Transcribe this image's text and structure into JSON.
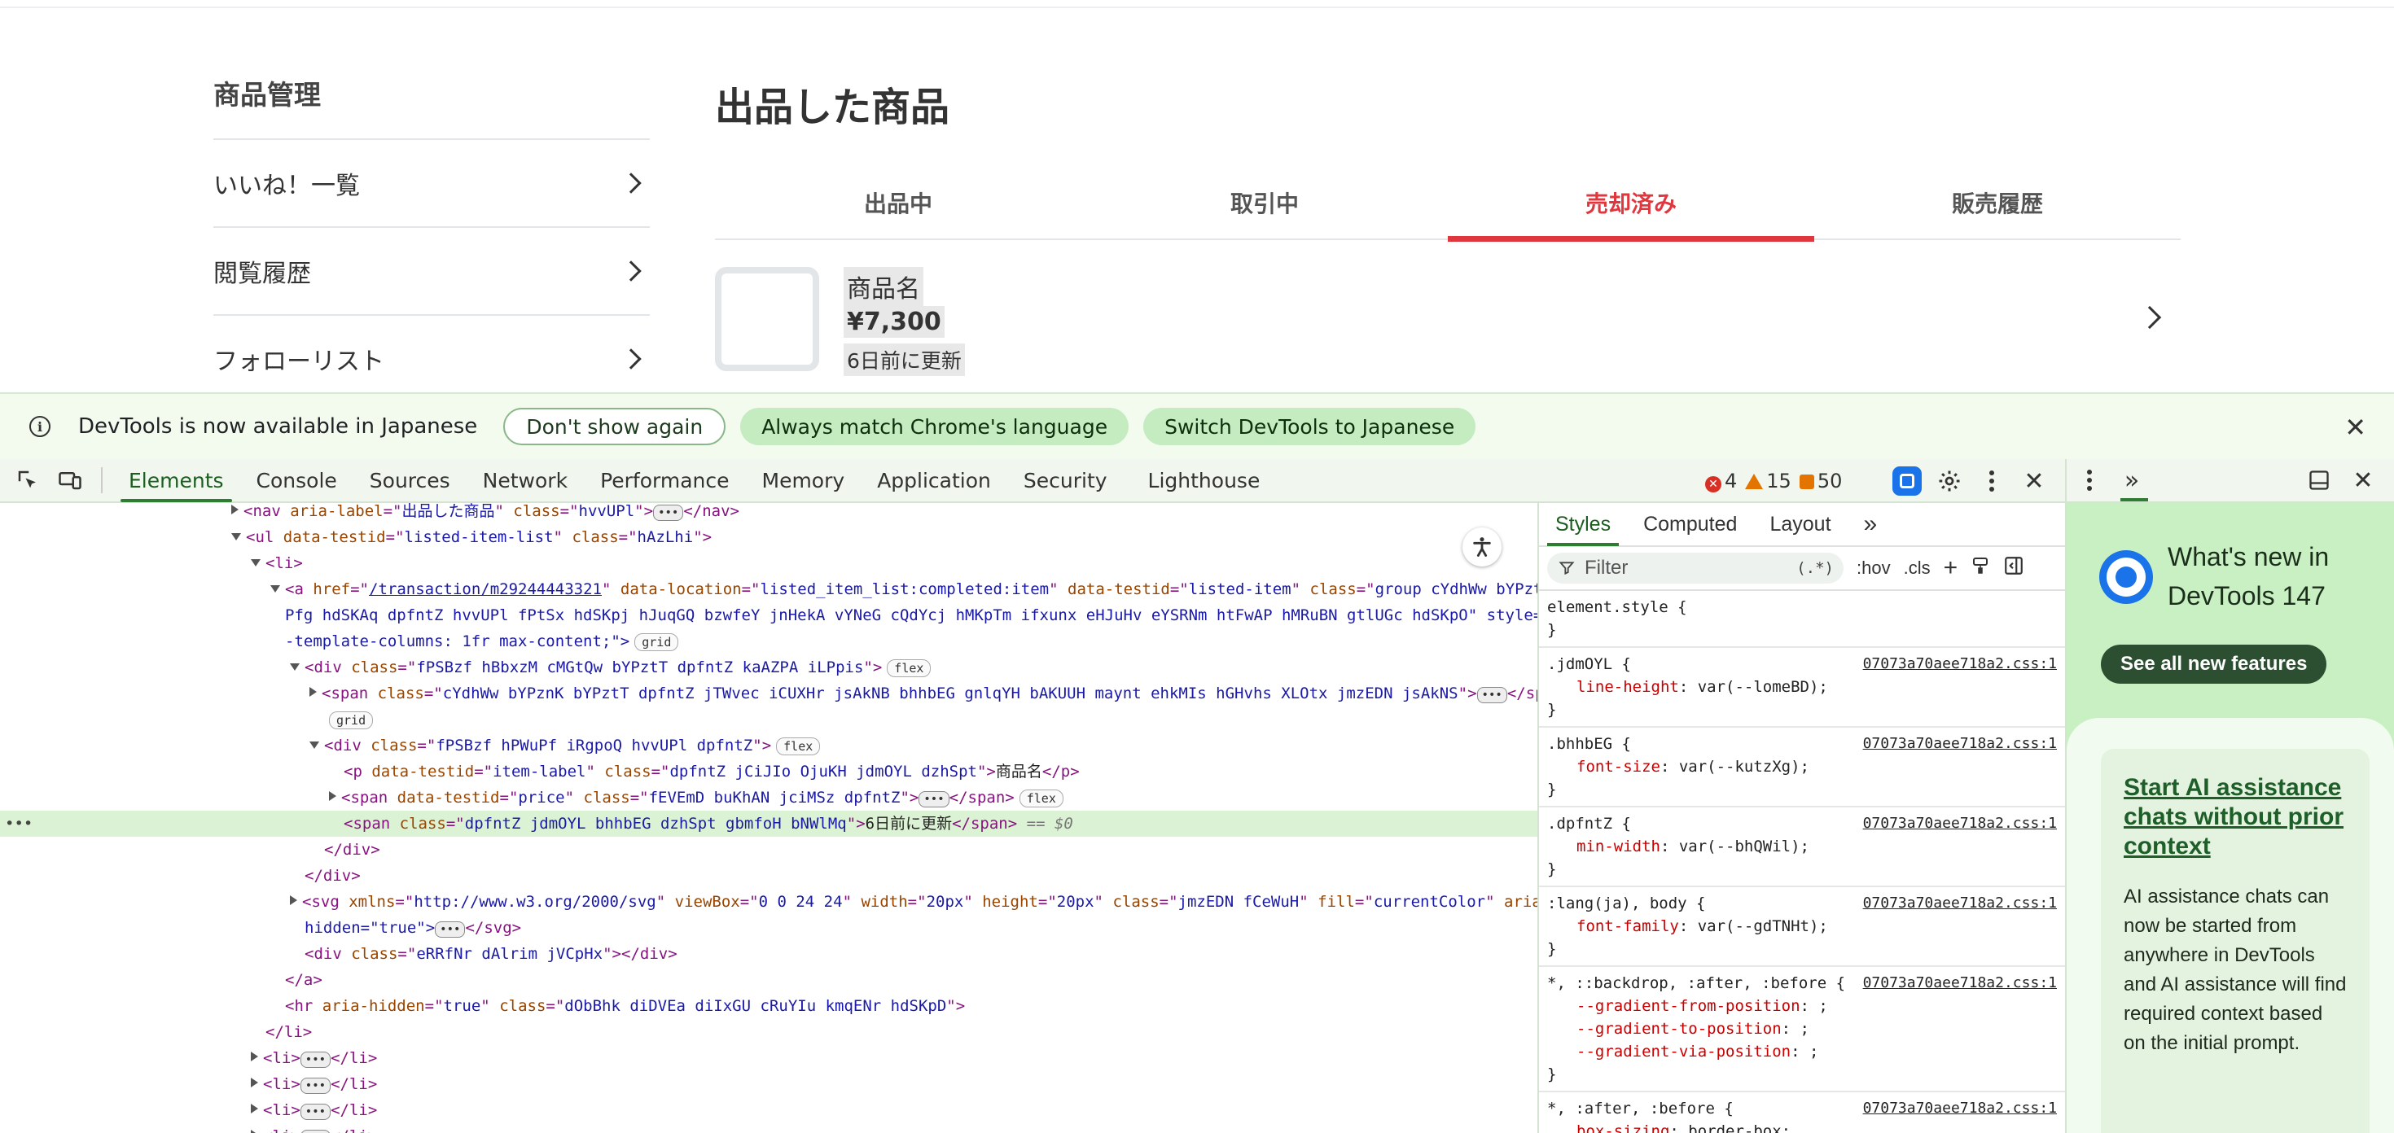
{
  "page": {
    "sidebar": {
      "title": "商品管理",
      "items": [
        {
          "label": "いいね！一覧"
        },
        {
          "label": "閲覧履歴"
        },
        {
          "label": "フォローリスト"
        }
      ]
    },
    "main_title": "出品した商品",
    "tabs": [
      {
        "label": "出品中"
      },
      {
        "label": "取引中"
      },
      {
        "label": "売却済み"
      },
      {
        "label": "販売履歴"
      }
    ],
    "item": {
      "name": "商品名",
      "price": "¥7,300",
      "updated": "6日前に更新"
    }
  },
  "infobar": {
    "message": "DevTools is now available in Japanese",
    "dont_show": "Don't show again",
    "match_language": "Always match Chrome's language",
    "switch_language": "Switch DevTools to Japanese"
  },
  "devtools": {
    "tabs": [
      "Elements",
      "Console",
      "Sources",
      "Network",
      "Performance",
      "Memory",
      "Application",
      "Security",
      "Lighthouse"
    ],
    "errors": "4",
    "warnings": "15",
    "issues": "50",
    "dom_lines": [
      {
        "pre": "<",
        "tag": "nav",
        "attrs": [
          [
            "aria-label",
            "出品した商品"
          ],
          [
            "class",
            "hvvUPl"
          ]
        ],
        "post": "</nav>",
        "dots": true
      },
      {
        "pre": "<",
        "tag": "ul",
        "attrs": [
          [
            "data-testid",
            "listed-item-list"
          ],
          [
            "class",
            "hAzLhi"
          ]
        ],
        "post": ""
      },
      {
        "pre": "<",
        "tag": "li",
        "attrs": [],
        "post": ""
      },
      {
        "pre": "<",
        "tag": "a",
        "attrs": [
          [
            "href",
            "/transaction/m29244443321"
          ],
          [
            "data-location",
            "listed_item_list:completed:item"
          ],
          [
            "data-testid",
            "listed-item"
          ],
          [
            "class",
            "group cYdhWw bYPztT eJK"
          ]
        ],
        "post": ""
      },
      {
        "cont": "Pfg hdSKAq dpfntZ hvvUPl fPtSx hdSKpj hJuqGQ bzwfeY jnHekA vYNeG cQdYcj hMKpTm ifxunx eHJuHv eYSRNm htFwAP hMRuBN gtlUGc hdSKpO\" style=\"grid"
      },
      {
        "cont": "-template-columns: 1fr max-content;\">",
        "badge": "grid"
      },
      {
        "pre": "<",
        "tag": "div",
        "attrs": [
          [
            "class",
            "fPSBzf hBbxzM cMGtQw bYPztT dpfntZ kaAZPA iLPpis"
          ]
        ],
        "post": "",
        "badge": "flex"
      },
      {
        "pre": "<",
        "tag": "span",
        "attrs": [
          [
            "class",
            "cYdhWw bYPznK bYPztT dpfntZ jTWvec iCUXHr jsAkNB bhhbEG gnlqYH bAKUUH maynt ehkMIs hGHvhs XLOtx jmzEDN jsAkNS"
          ]
        ],
        "post": "</span>",
        "dots": true
      },
      {
        "cont": "",
        "badge": "grid"
      },
      {
        "pre": "<",
        "tag": "div",
        "attrs": [
          [
            "class",
            "fPSBzf hPWuPf iRgpoQ hvvUPl dpfntZ"
          ]
        ],
        "post": "",
        "badge": "flex"
      },
      {
        "pre": "<",
        "tag": "p",
        "attrs": [
          [
            "data-testid",
            "item-label"
          ],
          [
            "class",
            "dpfntZ jCiJIo OjuKH jdmOYL dzhSpt"
          ]
        ],
        "text": "商品名",
        "post": "</p>"
      },
      {
        "pre": "<",
        "tag": "span",
        "attrs": [
          [
            "data-testid",
            "price"
          ],
          [
            "class",
            "fEVEmD buKhAN jciMSz dpfntZ"
          ]
        ],
        "post": "</span>",
        "dots": true,
        "badge": "flex"
      },
      {
        "pre": "<",
        "tag": "span",
        "attrs": [
          [
            "class",
            "dpfntZ jdmOYL bhhbEG dzhSpt gbmfoH bNWlMq"
          ]
        ],
        "text": "6日前に更新",
        "post": "</span>",
        "eq": "== $0"
      },
      {
        "close": "</div>"
      },
      {
        "close": "</div>"
      },
      {
        "pre": "<",
        "tag": "svg",
        "attrs": [
          [
            "xmlns",
            "http://www.w3.org/2000/svg"
          ],
          [
            "viewBox",
            "0 0 24 24"
          ],
          [
            "width",
            "20px"
          ],
          [
            "height",
            "20px"
          ],
          [
            "class",
            "jmzEDN fCeWuH"
          ],
          [
            "fill",
            "currentColor"
          ],
          [
            "aria-",
            ""
          ]
        ],
        "post": ""
      },
      {
        "cont": "hidden=\"true\">",
        "dots": true,
        "post": "</svg>"
      },
      {
        "pre": "<",
        "tag": "div",
        "attrs": [
          [
            "class",
            "eRRfNr dAlrim jVCpHx"
          ]
        ],
        "post": "</div>"
      },
      {
        "close": "</a>"
      },
      {
        "pre": "<",
        "tag": "hr",
        "attrs": [
          [
            "aria-hidden",
            "true"
          ],
          [
            "class",
            "dObBhk diDVEa diIxGU cRuYIu kmqENr hdSKpD"
          ]
        ],
        "post": ""
      },
      {
        "close": "</li>"
      },
      {
        "pre": "<",
        "tag": "li",
        "attrs": [],
        "post": "</li>",
        "dots": true
      },
      {
        "pre": "<",
        "tag": "li",
        "attrs": [],
        "post": "</li>",
        "dots": true
      },
      {
        "pre": "<",
        "tag": "li",
        "attrs": [],
        "post": "</li>",
        "dots": true
      },
      {
        "pre": "<",
        "tag": "li",
        "attrs": [],
        "post": "</li>",
        "dots": true
      }
    ],
    "styles": {
      "tabs": [
        "Styles",
        "Computed",
        "Layout"
      ],
      "filter_placeholder": "Filter",
      "regex": "(.*)",
      "hov": ":hov",
      "cls": ".cls",
      "rules": [
        {
          "selector": "element.style {",
          "props": [],
          "src": ""
        },
        {
          "selector": ".jdmOYL {",
          "props": [
            [
              "line-height",
              "var(--lomeBD);"
            ]
          ],
          "src": "07073a70aee718a2.css:1"
        },
        {
          "selector": ".bhhbEG {",
          "props": [
            [
              "font-size",
              "var(--kutzXg);"
            ]
          ],
          "src": "07073a70aee718a2.css:1"
        },
        {
          "selector": ".dpfntZ {",
          "props": [
            [
              "min-width",
              "var(--bhQWil);"
            ]
          ],
          "src": "07073a70aee718a2.css:1"
        },
        {
          "selector": ":lang(ja), body {",
          "props": [
            [
              "font-family",
              "var(--gdTNHt);"
            ]
          ],
          "src": "07073a70aee718a2.css:1"
        },
        {
          "selector": "*, ::backdrop, :after, :before {",
          "props": [
            [
              "--gradient-from-position",
              " ;"
            ],
            [
              "--gradient-to-position",
              " ;"
            ],
            [
              "--gradient-via-position",
              " ;"
            ]
          ],
          "src": "07073a70aee718a2.css:1"
        },
        {
          "selector": "*, :after, :before {",
          "props": [
            [
              "box-sizing",
              "border-box;"
            ]
          ],
          "src": "07073a70aee718a2.css:1"
        }
      ]
    },
    "whatsnew": {
      "title": "What's new in DevTools 147",
      "button": "See all new features",
      "card_link": "Start AI assistance chats without prior context",
      "card_desc": "AI assistance chats can now be started from anywhere in DevTools and AI assistance will find required context based on the initial prompt."
    }
  }
}
